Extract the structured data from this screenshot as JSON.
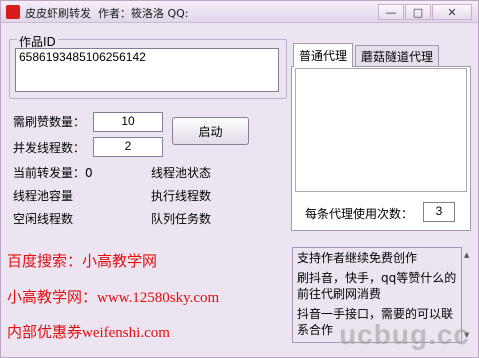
{
  "window": {
    "title": "皮皮虾刷转发  作者：筱洛洛 QQ:",
    "minimize": "—",
    "maximize": "□",
    "close": "✕"
  },
  "work": {
    "group_label": "作品ID",
    "id_value": "6586193485106256142"
  },
  "form": {
    "brush_count_label": "需刷赞数量：",
    "brush_count_value": "10",
    "threads_label": "并发线程数：",
    "threads_value": "2",
    "start_button": "启动"
  },
  "status": {
    "current_forward": "当前转发量：0",
    "pool_status": "线程池状态",
    "pool_capacity": "线程池容量",
    "exec_threads": "执行线程数",
    "idle_threads": "空闲线程数",
    "queue_tasks": "队列任务数"
  },
  "proxy": {
    "tabs": [
      "普通代理",
      "蘑菇隧道代理"
    ],
    "per_proxy_label": "每条代理使用次数：",
    "per_proxy_value": "3"
  },
  "promo": {
    "line1": "百度搜索：小高教学网",
    "line2": "小高教学网：www.12580sky.com",
    "line3": "内部优惠券weifenshi.com"
  },
  "notice": {
    "line1": "支持作者继续免费创作",
    "line2": "刷抖音，快手，qq等赞什么的前往代刷网消费",
    "line3": "抖音一手接口，需要的可以联系合作"
  },
  "watermark": "ucbug.cc"
}
